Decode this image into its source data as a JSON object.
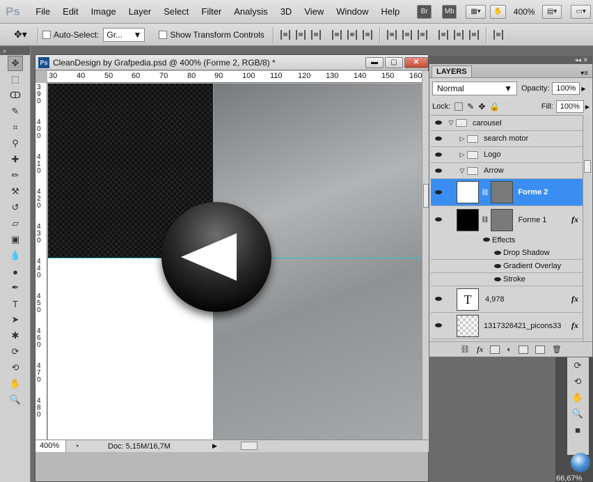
{
  "menubar": {
    "logo": "Ps",
    "items": [
      "File",
      "Edit",
      "Image",
      "Layer",
      "Select",
      "Filter",
      "Analysis",
      "3D",
      "View",
      "Window",
      "Help"
    ],
    "bridge": "Br",
    "minibridge": "Mb",
    "zoom": "400%"
  },
  "options": {
    "auto_select_label": "Auto-Select:",
    "auto_select_value": "Gr...",
    "show_transform_label": "Show Transform Controls"
  },
  "document": {
    "title": "CleanDesign by Grafpedia.psd @ 400% (Forme 2, RGB/8) *",
    "ruler_labels": [
      "30",
      "40",
      "50",
      "60",
      "70",
      "80",
      "90",
      "100",
      "110",
      "120",
      "130",
      "140",
      "150",
      "160"
    ],
    "vruler_labels": [
      "390",
      "400",
      "410",
      "420",
      "430",
      "440",
      "450",
      "460",
      "470",
      "480"
    ],
    "zoom": "400%",
    "doc_info": "Doc: 5,15M/16,7M"
  },
  "layers": {
    "tab": "LAYERS",
    "blend_mode": "Normal",
    "opacity_label": "Opacity:",
    "opacity_value": "100%",
    "lock_label": "Lock:",
    "fill_label": "Fill:",
    "fill_value": "100%",
    "items": [
      {
        "name": "carousel"
      },
      {
        "name": "search motor"
      },
      {
        "name": "Logo"
      },
      {
        "name": "Arrow"
      },
      {
        "name": "Forme 2"
      },
      {
        "name": "Forme 1"
      },
      {
        "name": "Effects"
      },
      {
        "name": "Drop Shadow"
      },
      {
        "name": "Gradient Overlay"
      },
      {
        "name": "Stroke"
      },
      {
        "name": "4,978"
      },
      {
        "name": "1317326421_picons33"
      }
    ]
  },
  "status": {
    "zoom_readout": "66,67%"
  }
}
